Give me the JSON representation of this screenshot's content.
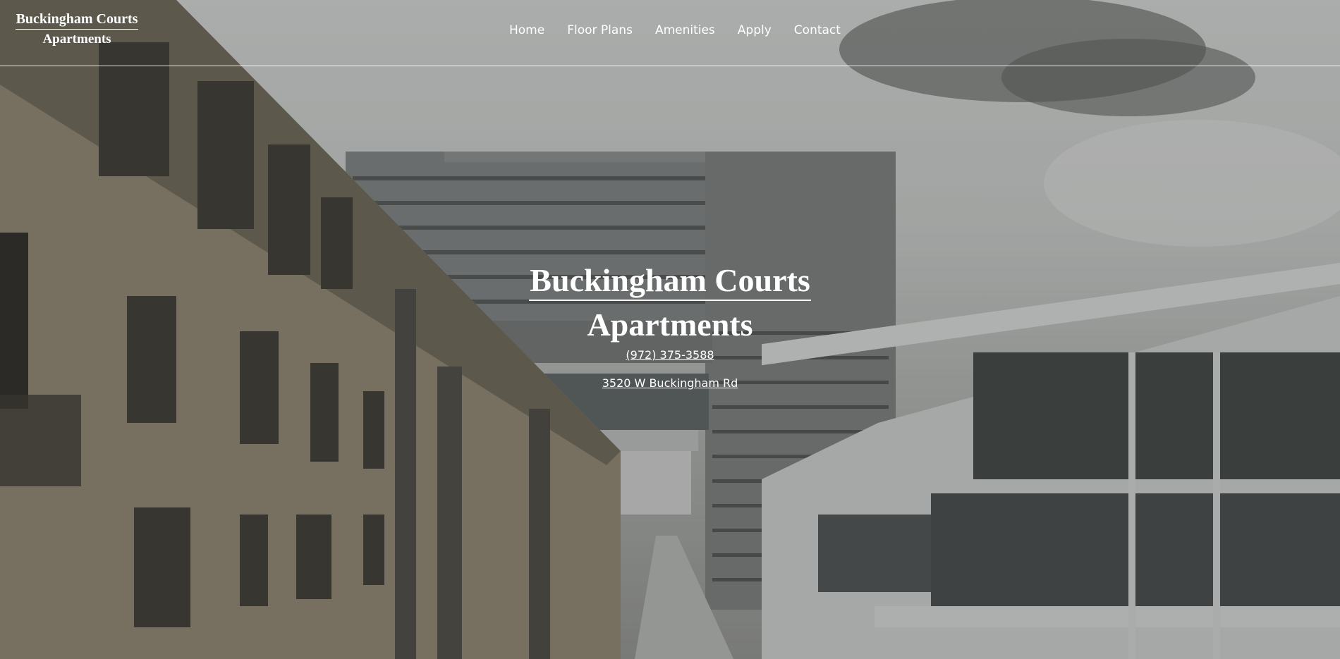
{
  "site": {
    "logo_line1": "Buckingham Courts",
    "logo_line2": "Apartments"
  },
  "nav": {
    "items": [
      "Home",
      "Floor Plans",
      "Amenities",
      "Apply",
      "Contact"
    ]
  },
  "hero": {
    "title_line1": "Buckingham Courts",
    "title_line2": "Apartments",
    "phone": "(972) 375-3588",
    "address": "3520 W Buckingham Rd"
  },
  "colors": {
    "text": "#ffffff",
    "overlay": "#282828"
  }
}
